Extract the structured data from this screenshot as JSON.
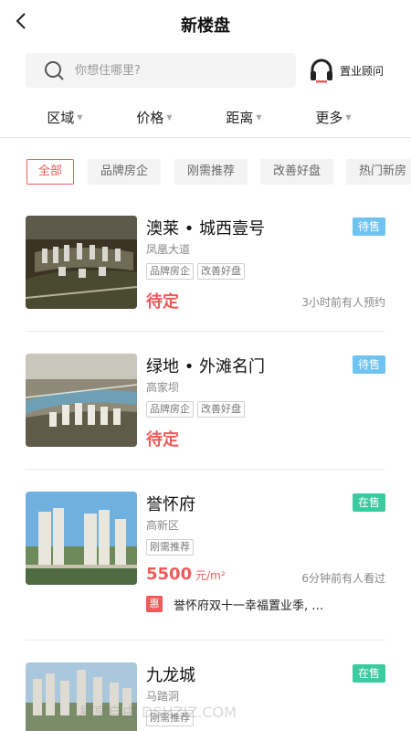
{
  "header": {
    "title": "新楼盘",
    "back_icon": "chevron-left-icon"
  },
  "search": {
    "placeholder": "你想住哪里?",
    "icon": "search-icon"
  },
  "advisor": {
    "label": "置业顾问",
    "icon": "headset-icon"
  },
  "filters": [
    {
      "label": "区域",
      "icon": "caret-down-icon"
    },
    {
      "label": "价格",
      "icon": "caret-down-icon"
    },
    {
      "label": "距离",
      "icon": "caret-down-icon"
    },
    {
      "label": "更多",
      "icon": "caret-down-icon"
    }
  ],
  "categories": [
    "全部",
    "品牌房企",
    "刚需推荐",
    "改善好盘",
    "热门新房"
  ],
  "active_category": "全部",
  "colors": {
    "accent": "#f05a5a",
    "presale": "#6ec3f0",
    "onsale": "#3ccaa0"
  },
  "listings": [
    {
      "name": "澳莱 • 城西壹号",
      "status": "待售",
      "district": "凤凰大道",
      "tags": [
        "品牌房企",
        "改善好盘"
      ],
      "price": "待定",
      "unit": "",
      "activity": "3小时前有人预约"
    },
    {
      "name": "绿地 • 外滩名门",
      "status": "待售",
      "district": "高家坝",
      "tags": [
        "品牌房企",
        "改善好盘"
      ],
      "price": "待定",
      "unit": "",
      "activity": ""
    },
    {
      "name": "誉怀府",
      "status": "在售",
      "district": "高新区",
      "tags": [
        "刚需推荐"
      ],
      "price": "5500",
      "unit": "元/m²",
      "activity": "6分钟前有人看过",
      "promo_badge": "惠",
      "promo": "誉怀府双十一幸福置业季, …"
    },
    {
      "name": "九龙城",
      "status": "在售",
      "district": "马踏洞",
      "tags": [
        "刚需推荐"
      ],
      "price": "",
      "unit": "",
      "activity": ""
    }
  ],
  "watermark": "易享自由 DSHZIZ.COM"
}
